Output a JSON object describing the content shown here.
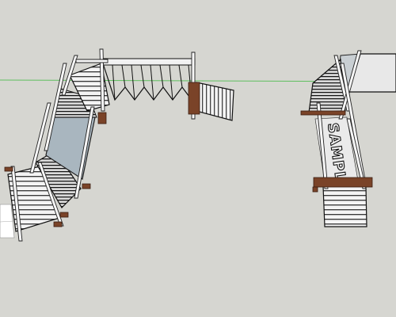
{
  "app": {
    "kind": "3D modeling viewport",
    "background_color": "#d6d6d1",
    "axis_color": "#5fbf5f"
  },
  "model": {
    "right_structure": {
      "stamp_text": "SAMPLE"
    }
  }
}
